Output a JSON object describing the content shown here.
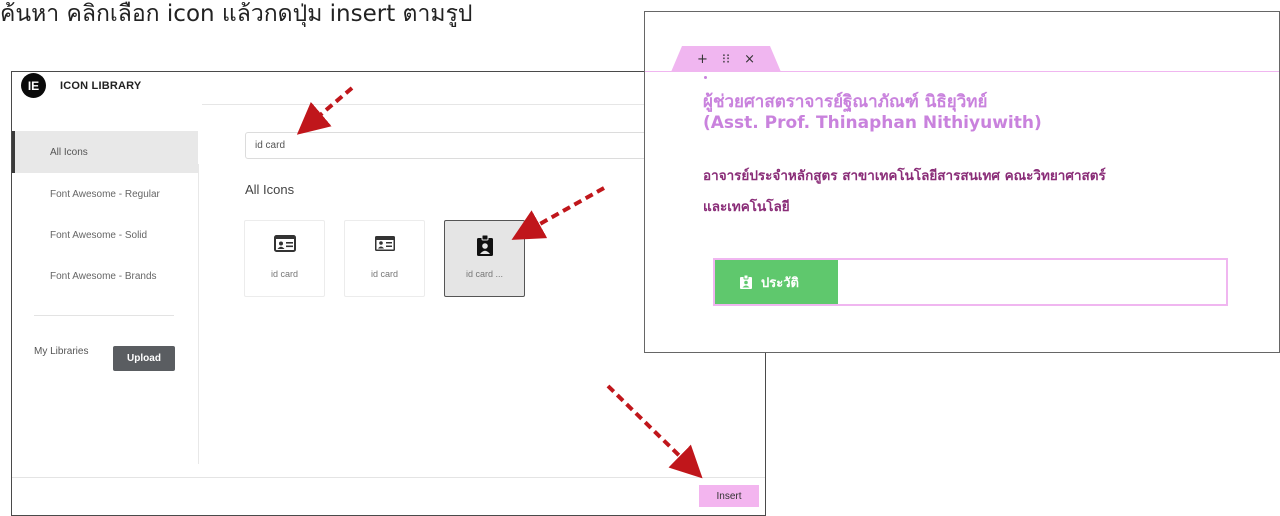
{
  "caption": "ค้นหา คลิกเลือก icon แล้วกดปุ่ม insert ตามรูป",
  "icon_library": {
    "title": "ICON LIBRARY",
    "sidebar": [
      {
        "label": "All Icons",
        "active": true
      },
      {
        "label": "Font Awesome - Regular",
        "active": false
      },
      {
        "label": "Font Awesome - Solid",
        "active": false
      },
      {
        "label": "Font Awesome - Brands",
        "active": false
      }
    ],
    "my_libraries_label": "My Libraries",
    "upload_label": "Upload",
    "search_value": "id card",
    "section_title": "All Icons",
    "tiles": [
      {
        "label": "id card",
        "icon": "id-card-icon",
        "selected": false
      },
      {
        "label": "id card",
        "icon": "id-card-icon",
        "selected": false
      },
      {
        "label": "id card ...",
        "icon": "id-badge-icon",
        "selected": true
      }
    ],
    "insert_label": "Insert"
  },
  "preview": {
    "handle": {
      "add": "+",
      "drag": "⁝⁝",
      "close": "×"
    },
    "name_th": "ผู้ช่วยศาสตราจารย์ฐิณาภัณฑ์ นิธิยุวิทย์",
    "name_en": "(Asst. Prof. Thinaphan Nithiyuwith)",
    "role_line1": "อาจารย์ประจำหลักสูตร สาขาเทคโนโลยีสารสนเทศ คณะวิทยาศาสตร์",
    "role_line2": "และเทคโนโลยี",
    "button_label": "ประวัติ"
  },
  "colors": {
    "accent_pink": "#f0b6f0",
    "name_purple": "#c982dd",
    "role_purple": "#8a2d78",
    "button_green": "#5fc86d",
    "arrow_red": "#c0161b"
  }
}
